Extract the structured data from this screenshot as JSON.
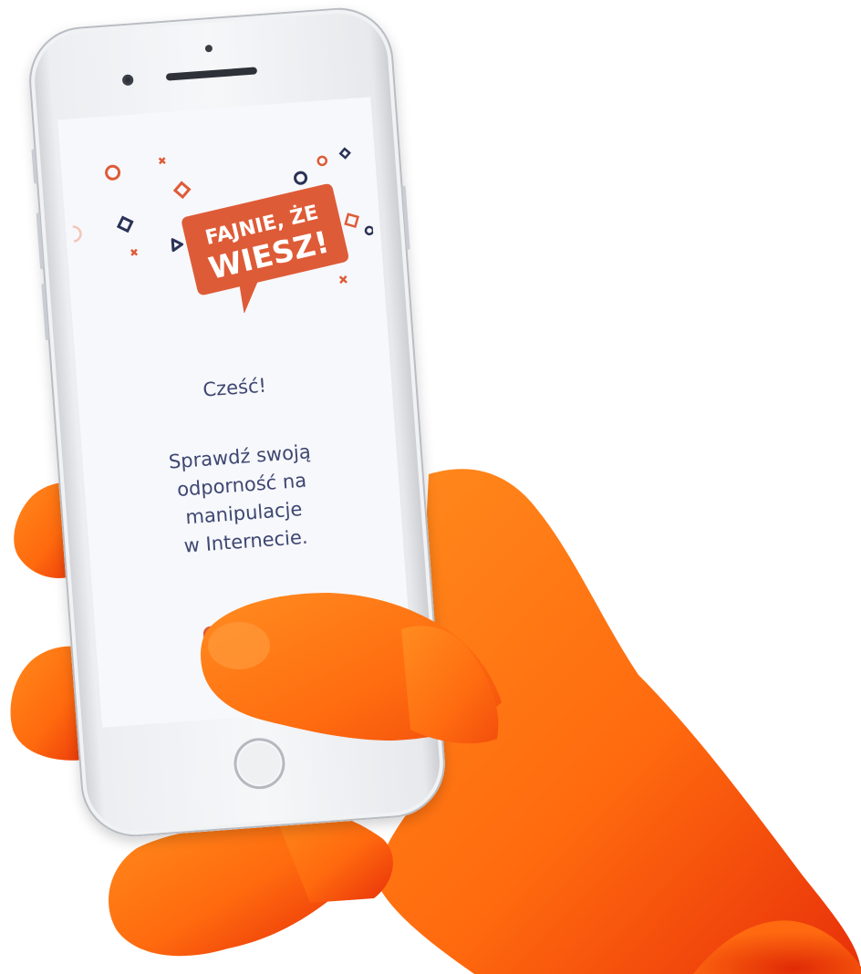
{
  "app": {
    "logo_line1": "FAJNIE, ŻE",
    "logo_line2": "WIESZ!"
  },
  "screen": {
    "greeting": "Cześć!",
    "message": "Sprawdź swoją\nodporność na\nmanipulacje\nw Internecie.",
    "start_button_label": ""
  },
  "colors": {
    "brand_orange": "#de5b37",
    "navy_text": "#3e4772",
    "hand_orange": "#ff7a12",
    "screen_bg": "#f7f8fb",
    "phone_silver": "#eceef1"
  },
  "icons": {
    "decorations": [
      "circle-icon",
      "diamond-icon",
      "cross-icon",
      "play-icon"
    ]
  }
}
